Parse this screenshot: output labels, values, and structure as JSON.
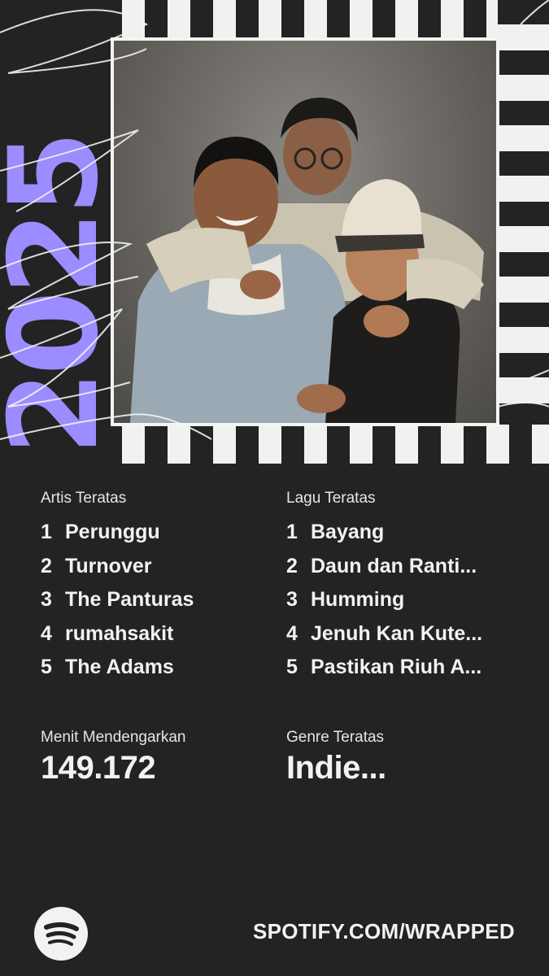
{
  "header": {
    "year_text": "2025",
    "accent_color": "#9b8cff"
  },
  "photo": {
    "description_icon": "band-photo"
  },
  "top_artists": {
    "label": "Artis Teratas",
    "items": [
      {
        "rank": "1",
        "name": "Perunggu"
      },
      {
        "rank": "2",
        "name": "Turnover"
      },
      {
        "rank": "3",
        "name": "The Panturas"
      },
      {
        "rank": "4",
        "name": "rumahsakit"
      },
      {
        "rank": "5",
        "name": "The Adams"
      }
    ]
  },
  "top_songs": {
    "label": "Lagu Teratas",
    "items": [
      {
        "rank": "1",
        "name": "Bayang"
      },
      {
        "rank": "2",
        "name": "Daun dan Ranti..."
      },
      {
        "rank": "3",
        "name": "Humming"
      },
      {
        "rank": "4",
        "name": "Jenuh Kan Kute..."
      },
      {
        "rank": "5",
        "name": "Pastikan Riuh A..."
      }
    ]
  },
  "minutes": {
    "label": "Menit Mendengarkan",
    "value": "149.172"
  },
  "genre": {
    "label": "Genre Teratas",
    "value": "Indie..."
  },
  "footer": {
    "url": "SPOTIFY.COM/WRAPPED",
    "logo_icon": "spotify-logo-icon"
  }
}
